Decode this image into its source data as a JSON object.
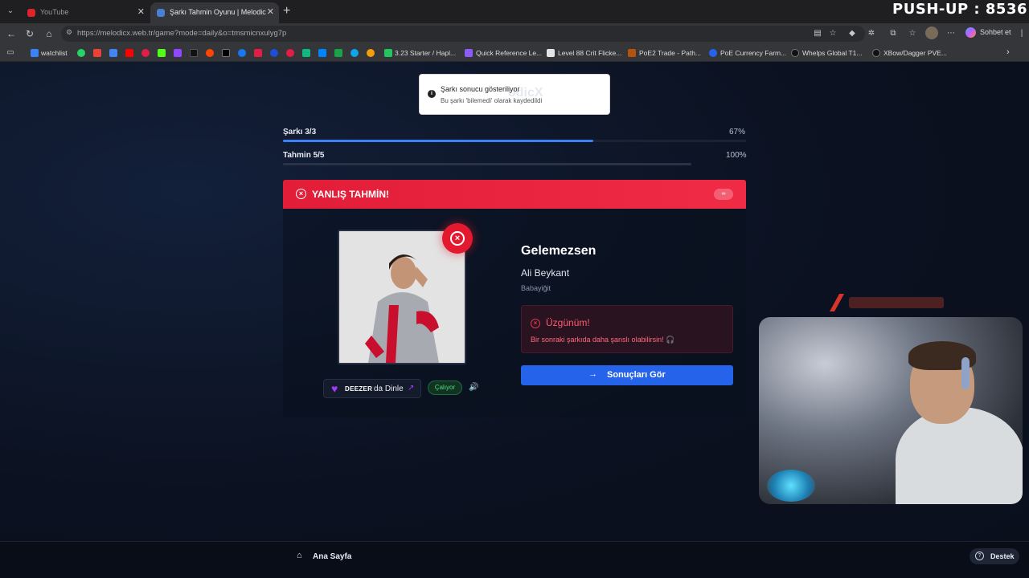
{
  "browser": {
    "tabs": [
      {
        "title": "YouTube",
        "active": false
      },
      {
        "title": "Şarkı Tahmin Oyunu | Melodic",
        "active": true
      }
    ],
    "url": "https://melodicx.web.tr/game?mode=daily&o=tmsmicnxulyg7p",
    "chat_label": "Sohbet et",
    "bookmarks": [
      "watchlist",
      "3.23 Starter / Hapl...",
      "Quick Reference Le...",
      "Level 88 Crit Flicke...",
      "PoE2 Trade - Path...",
      "PoE Currency Farm...",
      "Whelps Global T1...",
      "XBow/Dagger PVE..."
    ]
  },
  "overlay": {
    "pushup": "PUSH-UP : 8536"
  },
  "toast": {
    "title": "Şarkı sonucu gösteriliyor",
    "subtitle": "Bu şarkı 'bilemedi' olarak kaydedildi",
    "ghost_logo": "odicX"
  },
  "progress": {
    "song": {
      "label": "Şarkı 3/3",
      "percent_text": "67%",
      "value": 0.67
    },
    "guess": {
      "label": "Tahmin 5/5",
      "percent_text": "100%",
      "value": 1.0
    }
  },
  "banner": {
    "text": "YANLIŞ TAHMİN!",
    "timer": "∞"
  },
  "song": {
    "title": "Gelemezsen",
    "artist": "Ali Beykant",
    "album": "Babayiğit"
  },
  "deezer": {
    "brand": "DEEZER",
    "listen": "da Dinle",
    "status": "Çalıyor"
  },
  "sorry": {
    "title": "Üzgünüm!",
    "message": "Bir sonraki şarkıda daha şanslı olabilirsin! 🎧"
  },
  "results_button": "Sonuçları Gör",
  "footer": {
    "home": "Ana Sayfa",
    "support": "Destek"
  },
  "colors": {
    "accent_blue": "#2563eb",
    "error_red": "#e11d38",
    "success_green": "#4ade80",
    "deezer_purple": "#a238ff"
  }
}
